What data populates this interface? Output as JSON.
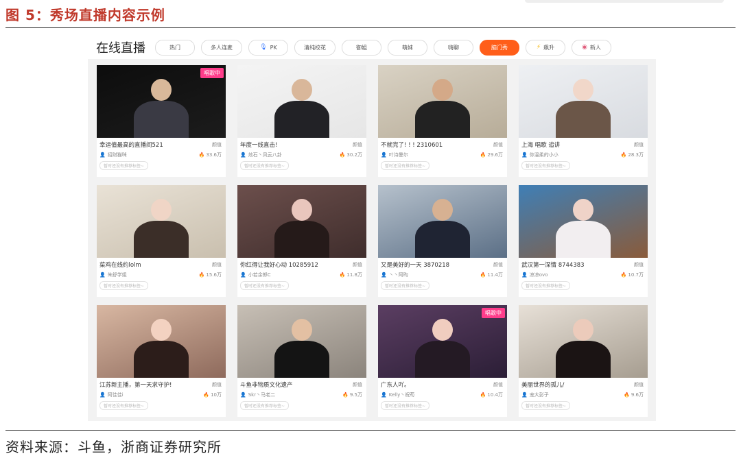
{
  "figure": {
    "title": "图 5：秀场直播内容示例",
    "source": "资料来源：斗鱼，浙商证券研究所"
  },
  "header": {
    "title": "在线直播",
    "tabs": [
      {
        "label": "热门",
        "icon": "",
        "active": false
      },
      {
        "label": "多人连麦",
        "icon": "",
        "active": false
      },
      {
        "label": "PK",
        "icon": "mic-icon",
        "active": false
      },
      {
        "label": "清纯校花",
        "icon": "",
        "active": false
      },
      {
        "label": "御姐",
        "icon": "",
        "active": false
      },
      {
        "label": "萌妹",
        "icon": "",
        "active": false
      },
      {
        "label": "嗨聊",
        "icon": "",
        "active": false
      },
      {
        "label": "脑门秀",
        "icon": "",
        "active": true
      },
      {
        "label": "飙升",
        "icon": "lightning-icon",
        "active": false
      },
      {
        "label": "新人",
        "icon": "new-badge-icon",
        "active": false
      }
    ]
  },
  "cards": [
    {
      "title": "幸运值最高的直播间521",
      "category": "颜值",
      "user": "招财猫咪",
      "views": "33.6万",
      "tag": "暂时还没有推荐标签~",
      "badge": "唱歌中",
      "bg1": "#0d0d0d",
      "bg2": "#1c1c1c",
      "person": "#3a3a44",
      "skin": "#d8b89a"
    },
    {
      "title": "年度一线直击!",
      "category": "颜值",
      "user": "炫石丶风云八卦",
      "views": "30.2万",
      "tag": "暂时还没有推荐标签~",
      "badge": "",
      "bg1": "#f4f4f4",
      "bg2": "#e6e6e6",
      "person": "#222226",
      "skin": "#d9b79a"
    },
    {
      "title": "不就完了! ! ! 2310601",
      "category": "颜值",
      "user": "叶诗曼尔",
      "views": "29.6万",
      "tag": "暂时还没有推荐标签~",
      "badge": "",
      "bg1": "#d9d2c4",
      "bg2": "#b7ac98",
      "person": "#222222",
      "skin": "#d4a988"
    },
    {
      "title": "上海 唱歌 追讲",
      "category": "颜值",
      "user": "你温柔的小小",
      "views": "28.3万",
      "tag": "暂时还没有推荐标签~",
      "badge": "",
      "bg1": "#eef0f3",
      "bg2": "#d8dbe0",
      "person": "#6b5648",
      "skin": "#f1d7c9"
    },
    {
      "title": "菜鸡在线约lolm",
      "category": "颜值",
      "user": "朱舒学姐",
      "views": "15.6万",
      "tag": "暂时还没有推荐标签~",
      "badge": "",
      "bg1": "#e9e2d6",
      "bg2": "#c9bfae",
      "person": "#3b2e28",
      "skin": "#f0d5c6"
    },
    {
      "title": "你红得让我好心动 10285912",
      "category": "颜值",
      "user": "小若余郎C",
      "views": "11.8万",
      "tag": "暂时还没有推荐标签~",
      "badge": "",
      "bg1": "#6c4f4c",
      "bg2": "#3f2d2c",
      "person": "#251a19",
      "skin": "#e9c6bd"
    },
    {
      "title": "又是美好的一天 3870218",
      "category": "颜值",
      "user": "丶丶阿昀",
      "views": "11.4万",
      "tag": "暂时还没有推荐标签~",
      "badge": "",
      "bg1": "#b6c1cc",
      "bg2": "#5b6f86",
      "person": "#1f2433",
      "skin": "#d7b192"
    },
    {
      "title": "武汉第一深情 8744383",
      "category": "颜值",
      "user": "凉凉ovo",
      "views": "10.7万",
      "tag": "暂时还没有推荐标签~",
      "badge": "",
      "bg1": "#3f7fb6",
      "bg2": "#8a5b3a",
      "person": "#f2eef0",
      "skin": "#efd3c8"
    },
    {
      "title": "江苏新主播，第一天求守护!",
      "category": "颜值",
      "user": "阿佳佳i",
      "views": "10万",
      "tag": "暂时还没有推荐标签~",
      "badge": "",
      "bg1": "#d8b7a2",
      "bg2": "#8e6a5c",
      "person": "#2c1d1a",
      "skin": "#f3d2c1"
    },
    {
      "title": "斗鱼非物质文化遗产",
      "category": "颜值",
      "user": "Skr丶马老二",
      "views": "9.5万",
      "tag": "暂时还没有推荐标签~",
      "badge": "",
      "bg1": "#c7bfb5",
      "bg2": "#8b847c",
      "person": "#141414",
      "skin": "#e3c0a3"
    },
    {
      "title": "广东人吖。",
      "category": "颜值",
      "user": "Kelly丶祝苟",
      "views": "10.4万",
      "tag": "暂时还没有推荐标签~",
      "badge": "唱歌中",
      "bg1": "#5b3e62",
      "bg2": "#2b1e36",
      "person": "#241a24",
      "skin": "#f0cdbf"
    },
    {
      "title": "美丽世界的孤儿/",
      "category": "颜值",
      "user": "宠大彭子",
      "views": "9.6万",
      "tag": "暂时还没有推荐标签~",
      "badge": "",
      "bg1": "#e7e0d7",
      "bg2": "#a69d90",
      "person": "#1b1414",
      "skin": "#eccbbb"
    }
  ]
}
